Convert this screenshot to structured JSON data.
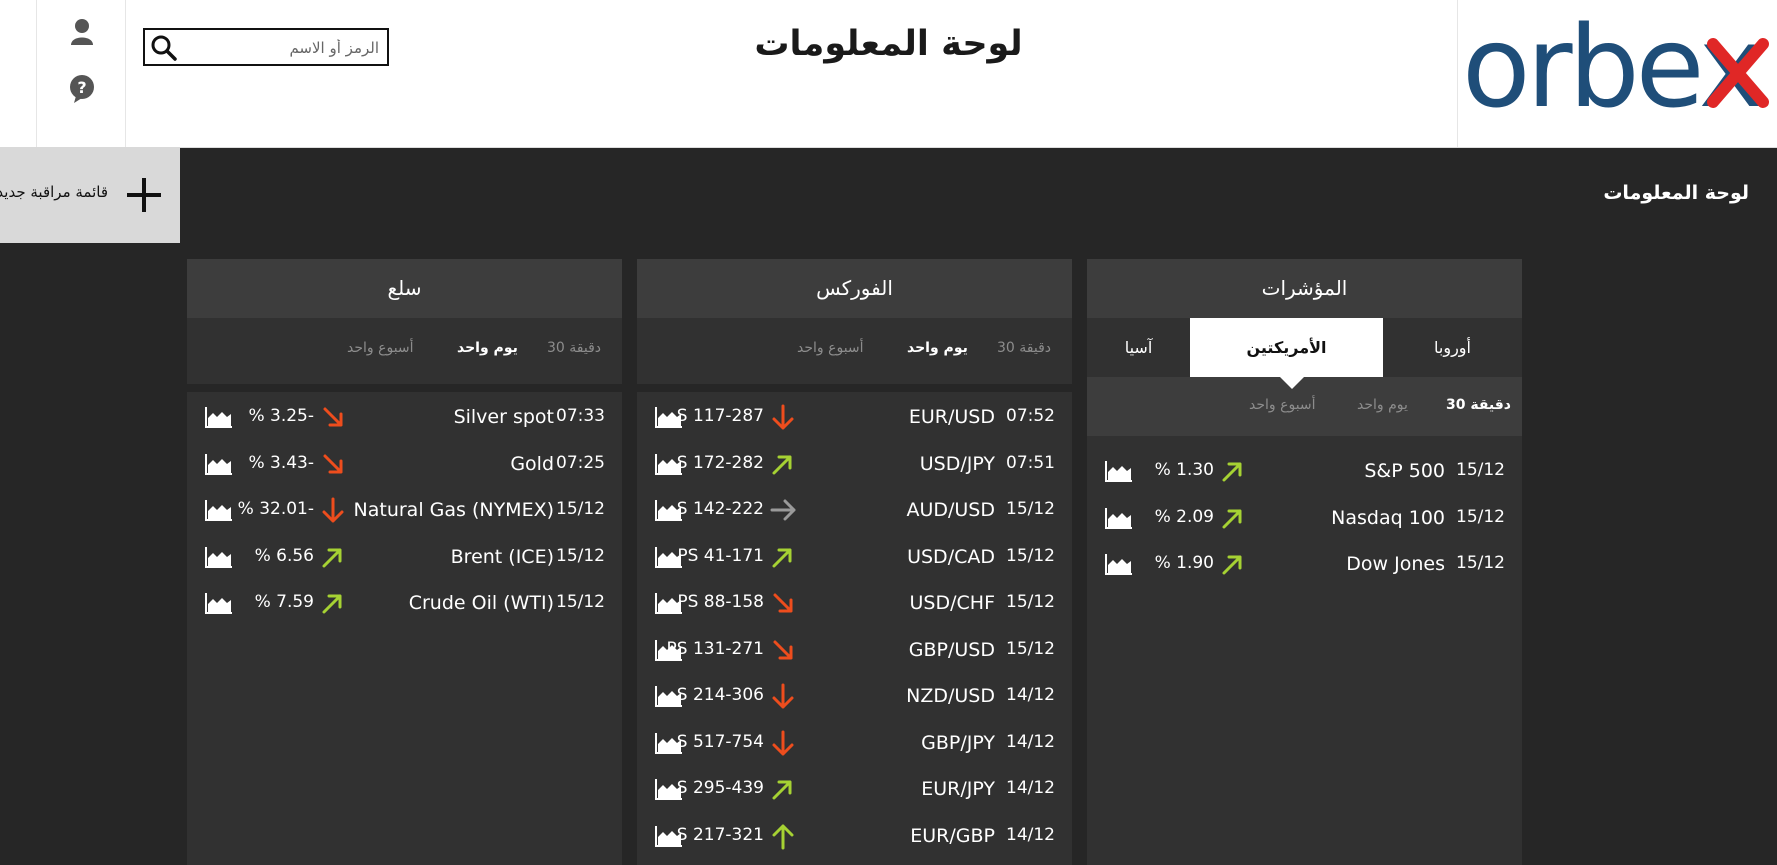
{
  "header": {
    "title": "لوحة المعلومات",
    "logo_text": "orbex",
    "search_placeholder": "الرمز أو الاسم",
    "cut_label": "ا"
  },
  "toolbar": {
    "new_watchlist": "قائمة مراقبة جديد",
    "dashboard_label": "لوحة المعلومات"
  },
  "colors": {
    "up": "#a6d233",
    "down": "#ee4d1d",
    "flat": "#9a9a9a",
    "brand_blue": "#1f4e79",
    "brand_red": "#e02726"
  },
  "panels": {
    "indices": {
      "title": "المؤشرات",
      "regions": [
        "أوروبا",
        "الأمريكتين",
        "آسيا"
      ],
      "active_region": "الأمريكتين",
      "time_tabs": [
        "30 دقيقة",
        "يوم واحد",
        "أسبوع واحد"
      ],
      "rows": [
        {
          "time": "15/12",
          "name": "S&P 500",
          "change": "% 1.30",
          "dir": "up"
        },
        {
          "time": "15/12",
          "name": "Nasdaq 100",
          "change": "% 2.09",
          "dir": "up"
        },
        {
          "time": "15/12",
          "name": "Dow Jones",
          "change": "% 1.90",
          "dir": "up"
        }
      ]
    },
    "forex": {
      "title": "الفوركس",
      "time_tabs": [
        "30 دقيقة",
        "يوم واحد",
        "أسبوع واحد"
      ],
      "rows": [
        {
          "time": "07:52",
          "name": "EUR/USD",
          "change": "S 117-287",
          "dir": "down"
        },
        {
          "time": "07:51",
          "name": "USD/JPY",
          "change": "S 172-282",
          "dir": "up"
        },
        {
          "time": "15/12",
          "name": "AUD/USD",
          "change": "S 142-222",
          "dir": "flat"
        },
        {
          "time": "15/12",
          "name": "USD/CAD",
          "change": "PS 41-171",
          "dir": "up"
        },
        {
          "time": "15/12",
          "name": "USD/CHF",
          "change": "PS 88-158",
          "dir": "downright"
        },
        {
          "time": "15/12",
          "name": "GBP/USD",
          "change": "PS 131-271",
          "dir": "downright"
        },
        {
          "time": "14/12",
          "name": "NZD/USD",
          "change": "S 214-306",
          "dir": "down"
        },
        {
          "time": "14/12",
          "name": "GBP/JPY",
          "change": "S 517-754",
          "dir": "down"
        },
        {
          "time": "14/12",
          "name": "EUR/JPY",
          "change": "S 295-439",
          "dir": "up"
        },
        {
          "time": "14/12",
          "name": "EUR/GBP",
          "change": "S 217-321",
          "dir": "upstraight"
        }
      ]
    },
    "commodities": {
      "title": "سلع",
      "time_tabs": [
        "30 دقيقة",
        "يوم واحد",
        "أسبوع واحد"
      ],
      "rows": [
        {
          "time": "07:33",
          "name": "Silver spot",
          "change": "% 3.25-",
          "dir": "downright"
        },
        {
          "time": "07:25",
          "name": "Gold",
          "change": "% 3.43-",
          "dir": "downright"
        },
        {
          "time": "15/12",
          "name": "Natural Gas (NYMEX)",
          "change": "% 32.01-",
          "dir": "down"
        },
        {
          "time": "15/12",
          "name": "Brent (ICE)",
          "change": "% 6.56",
          "dir": "up"
        },
        {
          "time": "15/12",
          "name": "Crude Oil (WTI)",
          "change": "% 7.59",
          "dir": "up"
        }
      ]
    }
  }
}
